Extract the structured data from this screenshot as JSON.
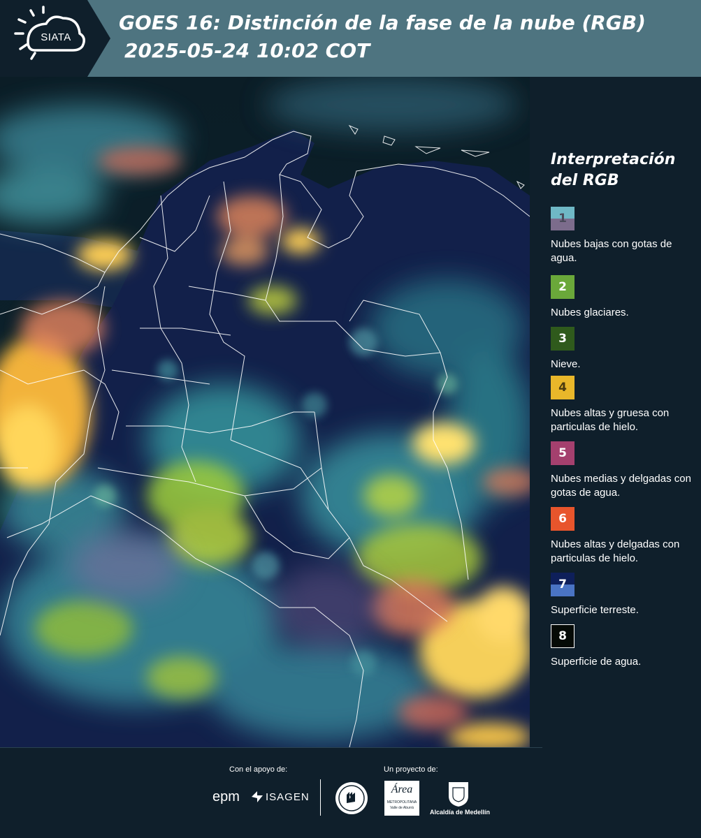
{
  "header": {
    "logo_text": "SIATA",
    "title_line1": "GOES 16: Distinción de la fase de la nube (RGB)",
    "title_line2": "2025-05-24 10:02 COT"
  },
  "legend": {
    "title": "Interpretación del RGB",
    "items": [
      {
        "number": "1",
        "label": "Nubes bajas con gotas de agua.",
        "top_color": "#6fb8c6",
        "bottom_color": "#7c6c8c",
        "num_color": "#4a4a5a"
      },
      {
        "number": "2",
        "label": "Nubes glaciares.",
        "top_color": "#6aa83a",
        "bottom_color": "#6aa83a",
        "num_color": "#ffffff"
      },
      {
        "number": "3",
        "label": "Nieve.",
        "top_color": "#2f5a1c",
        "bottom_color": "#2f5a1c",
        "num_color": "#ffffff"
      },
      {
        "number": "4",
        "label": "Nubes altas y gruesa con particulas de hielo.",
        "top_color": "#e9b72a",
        "bottom_color": "#e9b72a",
        "num_color": "#4a3a10"
      },
      {
        "number": "5",
        "label": "Nubes medias y delgadas con gotas de agua.",
        "top_color": "#a4406e",
        "bottom_color": "#a4406e",
        "num_color": "#ffffff"
      },
      {
        "number": "6",
        "label": "Nubes altas y delgadas con particulas de hielo.",
        "top_color": "#e8552c",
        "bottom_color": "#e8552c",
        "num_color": "#ffffff"
      },
      {
        "number": "7",
        "label": "Superficie terreste.",
        "top_color": "#0e1f5a",
        "bottom_color": "#4a74c4",
        "num_color": "#ffffff"
      },
      {
        "number": "8",
        "label": "Superficie de agua.",
        "top_color": "#050a06",
        "bottom_color": "#050a06",
        "num_color": "#ffffff"
      }
    ]
  },
  "footer": {
    "support_label": "Con el apoyo de:",
    "project_label": "Un proyecto de:",
    "sponsor_epm": "epm",
    "sponsor_isagen": "ISAGEN",
    "area_logo_text": "Área",
    "area_logo_sub": "METROPOLITANA",
    "area_logo_sub2": "Valle de Aburrá",
    "alcaldia_text": "Alcaldía de Medellín"
  },
  "colors": {
    "header_bg": "#4e7480",
    "logo_bg": "#0f1f2b",
    "page_bg": "#0f1f2b"
  }
}
